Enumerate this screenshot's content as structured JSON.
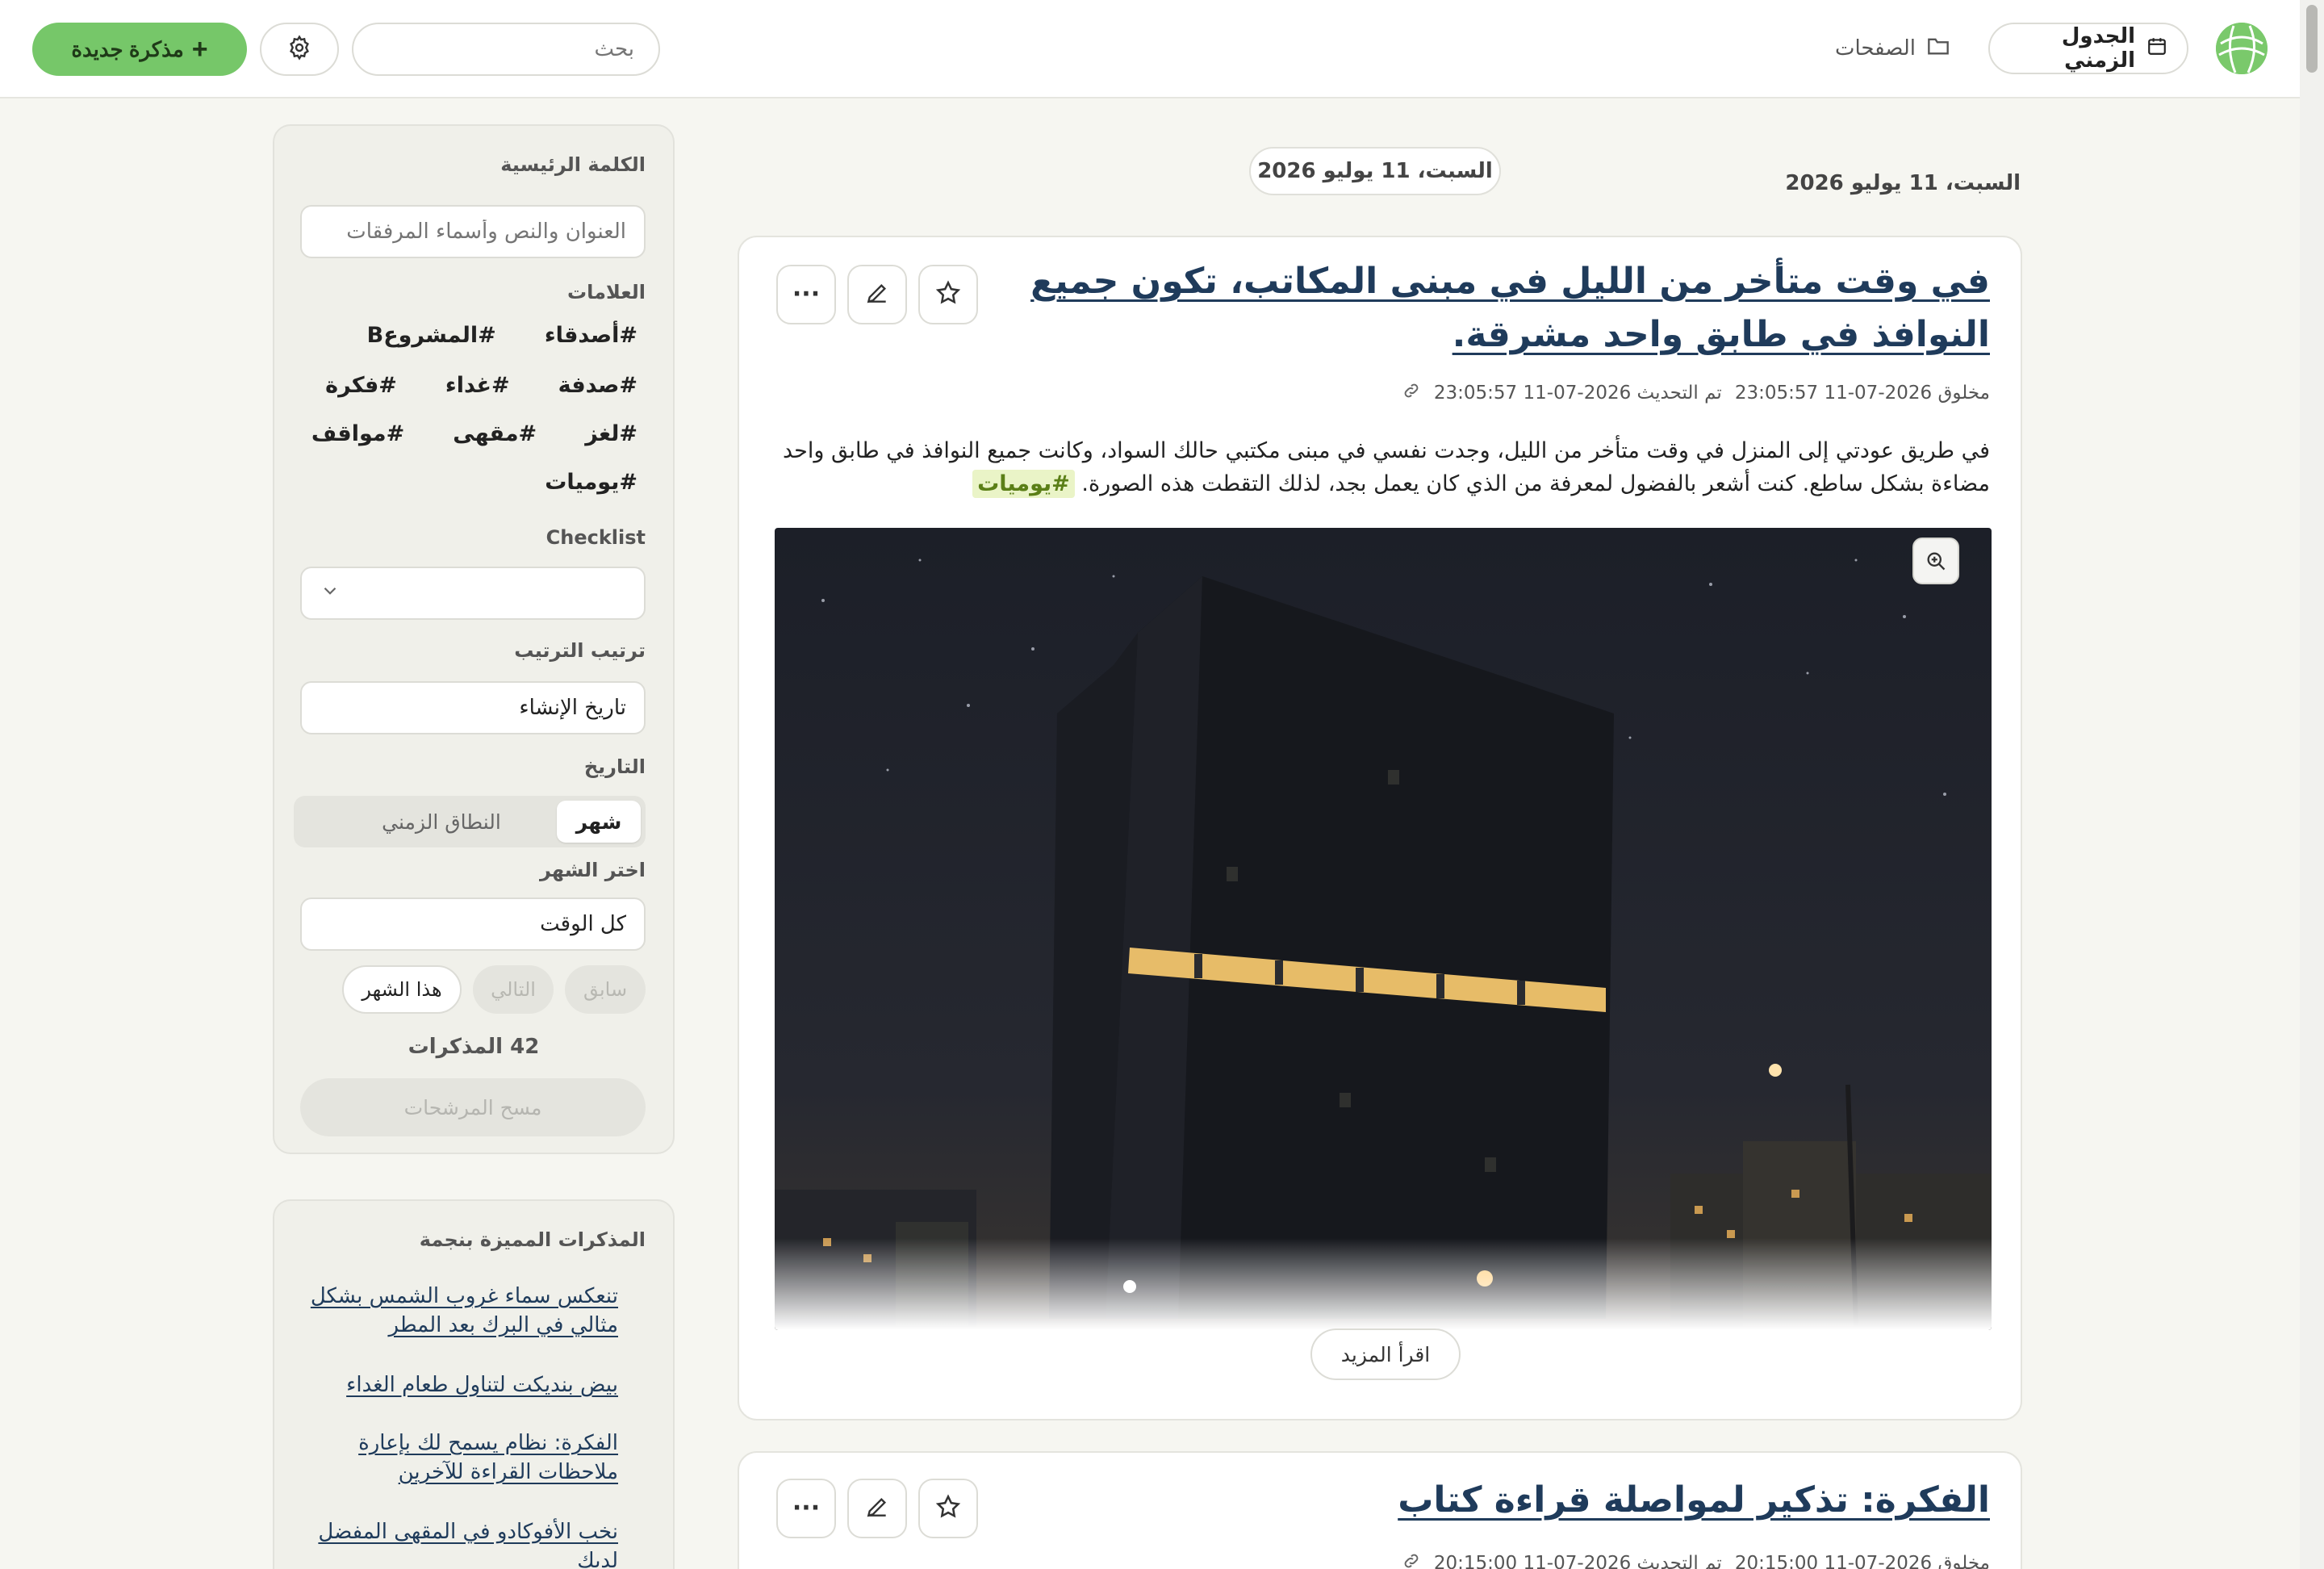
{
  "header": {
    "timeline_label": "الجدول الزمني",
    "pages_label": "الصفحات",
    "search_placeholder": "بحث",
    "new_note_label": "مذكرة جديدة"
  },
  "timeline": {
    "date_heading": "السبت، 11 يوليو 2026",
    "date_chip": "السبت، 11 يوليو 2026",
    "cards": [
      {
        "title": "في وقت متأخر من الليل في مبنى المكاتب، تكون جميع النوافذ في طابق واحد مشرقة.",
        "created": "مخلوق 2026-07-11 23:05:57",
        "updated": "تم التحديث 2026-07-11 23:05:57",
        "body": "في طريق عودتي إلى المنزل في وقت متأخر من الليل، وجدت نفسي في مبنى مكتبي حالك السواد، وكانت جميع النوافذ في طابق واحد مضاءة بشكل ساطع. كنت أشعر بالفضول لمعرفة من الذي كان يعمل بجد، لذلك التقطت هذه الصورة.",
        "tag": "#يوميات",
        "read_more": "اقرأ المزيد"
      },
      {
        "title": "الفكرة: تذكير لمواصلة قراءة كتاب",
        "created": "مخلوق 2026-07-11 20:15:00",
        "updated": "تم التحديث 2026-07-11 20:15:00"
      }
    ]
  },
  "filters": {
    "keyword_label": "الكلمة الرئيسية",
    "keyword_placeholder": "العنوان والنص وأسماء المرفقات",
    "tags_label": "العلامات",
    "tags": [
      [
        "#أصدقاء",
        "#المشروعB"
      ],
      [
        "#صدفة",
        "#غداء",
        "#فكرة"
      ],
      [
        "#لغز",
        "#مقهى",
        "#مواقف"
      ],
      [
        "#يوميات"
      ]
    ],
    "checklist_label": "Checklist",
    "checklist_value": "",
    "sort_label": "ترتيب الترتيب",
    "sort_value": "تاريخ الإنشاء",
    "date_label": "التاريخ",
    "date_mode_month": "شهر",
    "date_mode_range": "النطاق الزمني",
    "month_label": "اختر الشهر",
    "month_value": "كل الوقت",
    "prev_label": "سابق",
    "next_label": "التالي",
    "this_month_label": "هذا الشهر",
    "count_label": "42 المذكرات",
    "clear_label": "مسح المرشحات"
  },
  "starred": {
    "heading": "المذكرات المميزة بنجمة",
    "items": [
      "تنعكس سماء غروب الشمس بشكل مثالي في البرك بعد المطر",
      "بيض بنديكت لتناول طعام الغداء",
      "الفكرة: نظام يسمح لك بإعارة ملاحظات القراءة للآخرين",
      "نخب الأفوكادو في المقهى المفضل لديك"
    ]
  },
  "colors": {
    "accent_green": "#76c769",
    "link_blue": "#1f3b5b",
    "tag_bg": "#eaf4c7"
  }
}
